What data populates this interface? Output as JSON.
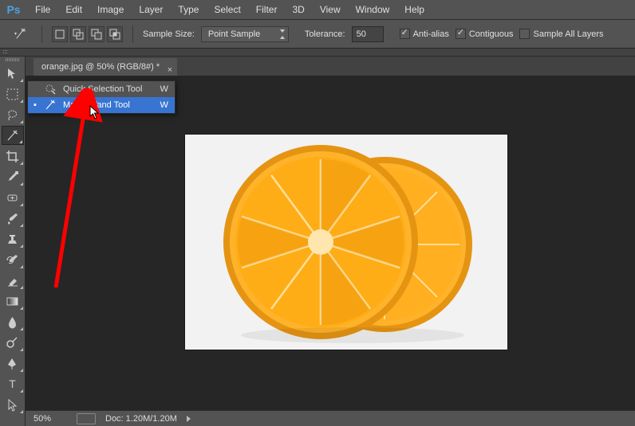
{
  "app": {
    "logo_text": "Ps"
  },
  "menubar": [
    "File",
    "Edit",
    "Image",
    "Layer",
    "Type",
    "Select",
    "Filter",
    "3D",
    "View",
    "Window",
    "Help"
  ],
  "optionsbar": {
    "sample_size_label": "Sample Size:",
    "sample_size_value": "Point Sample",
    "tolerance_label": "Tolerance:",
    "tolerance_value": "50",
    "anti_alias_label": "Anti-alias",
    "anti_alias_checked": true,
    "contiguous_label": "Contiguous",
    "contiguous_checked": true,
    "sample_all_label": "Sample All Layers",
    "sample_all_checked": false
  },
  "document": {
    "tab_title": "orange.jpg @ 50% (RGB/8#) *"
  },
  "toolbar": {
    "tools": [
      "move",
      "marquee",
      "lasso",
      "wand",
      "crop",
      "eyedropper",
      "healing",
      "brush",
      "stamp",
      "history-brush",
      "eraser",
      "gradient",
      "blur",
      "dodge",
      "pen",
      "type",
      "path-select"
    ],
    "active_index": 3
  },
  "flyout": {
    "items": [
      {
        "label": "Quick Selection Tool",
        "shortcut": "W",
        "selected": false,
        "icon": "quick-selection-icon"
      },
      {
        "label": "Magic Wand Tool",
        "shortcut": "W",
        "selected": true,
        "icon": "magic-wand-icon"
      }
    ]
  },
  "statusbar": {
    "zoom": "50%",
    "doc_info": "Doc: 1.20M/1.20M"
  },
  "colors": {
    "accent": "#3874d1",
    "annotation_red": "#ff0000",
    "orange_peel": "#f39c12",
    "orange_flesh": "#ffae1a",
    "orange_dark": "#e07b00"
  }
}
